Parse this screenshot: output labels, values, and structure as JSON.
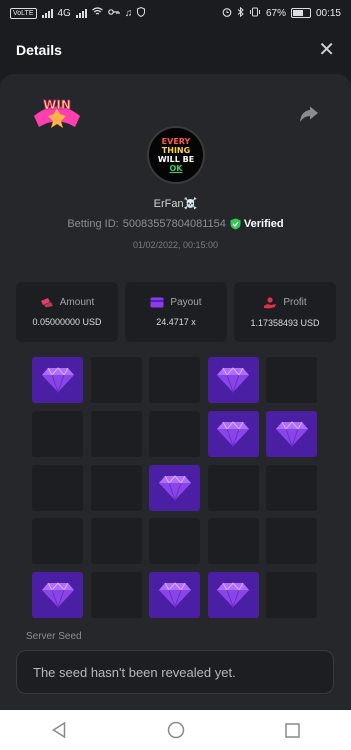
{
  "status_bar": {
    "left_chips": [
      "VoLTE",
      "4G"
    ],
    "battery": "67%",
    "time": "00:15"
  },
  "header": {
    "title": "Details",
    "close_icon": "close-icon"
  },
  "badge": {
    "text": "WIN"
  },
  "avatar": {
    "lines": [
      "EVERY",
      "THING",
      "WILL BE",
      "OK"
    ]
  },
  "user": {
    "name": "ErFan☠️",
    "betting_id_label": "Betting ID:",
    "betting_id": "5008355780408115​4",
    "verified_label": "Verified",
    "timestamp": "01/02/2022, 00:15:00"
  },
  "stats": [
    {
      "label": "Amount",
      "value": "0.05000000 USD",
      "icon": "amount-icon",
      "color": "#e0416a"
    },
    {
      "label": "Payout",
      "value": "24.4717 x",
      "icon": "payout-card-icon",
      "color": "#8b3cf0"
    },
    {
      "label": "Profit",
      "value": "1.17358493 USD",
      "icon": "profit-hand-icon",
      "color": "#e0304a"
    }
  ],
  "grid": {
    "rows": 5,
    "cols": 5,
    "gems": [
      [
        true,
        false,
        false,
        true,
        false
      ],
      [
        false,
        false,
        false,
        true,
        true
      ],
      [
        false,
        false,
        true,
        false,
        false
      ],
      [
        false,
        false,
        false,
        false,
        false
      ],
      [
        true,
        false,
        true,
        true,
        false
      ]
    ]
  },
  "seed": {
    "label": "Server Seed",
    "value": "The seed hasn't been revealed yet."
  },
  "colors": {
    "background": "#1b1c1f",
    "panel": "#26272b",
    "gem_tile": "#4a1fa3",
    "verified": "#2ecc52"
  }
}
